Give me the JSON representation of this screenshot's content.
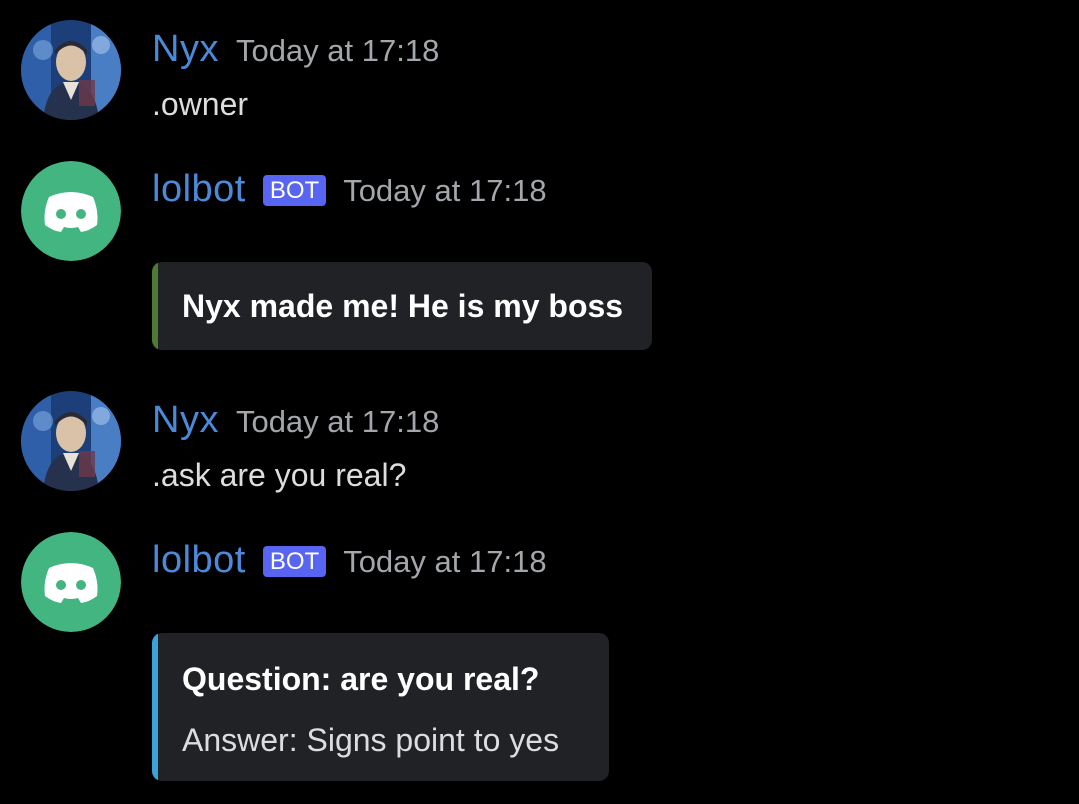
{
  "colors": {
    "background": "#000000",
    "username": "#4b8ad9",
    "bot_tag": "#5865f2",
    "discord_avatar_bg": "#43b581",
    "embed_bg": "#202225",
    "embed_bar_1": "#4e7a36",
    "embed_bar_2": "#3ba3d8"
  },
  "messages": [
    {
      "author": "Nyx",
      "timestamp": "Today at 17:18",
      "avatar_icon": "user-portrait-avatar",
      "content": ".owner"
    },
    {
      "author": "lolbot",
      "bot_tag": "BOT",
      "timestamp": "Today at 17:18",
      "avatar_icon": "discord-logo-icon",
      "embed": {
        "title": "Nyx made me! He is my boss"
      }
    },
    {
      "author": "Nyx",
      "timestamp": "Today at 17:18",
      "avatar_icon": "user-portrait-avatar",
      "content": ".ask are you real?"
    },
    {
      "author": "lolbot",
      "bot_tag": "BOT",
      "timestamp": "Today at 17:18",
      "avatar_icon": "discord-logo-icon",
      "embed": {
        "title": "Question: are you real?",
        "description": "Answer: Signs point to yes"
      }
    }
  ]
}
